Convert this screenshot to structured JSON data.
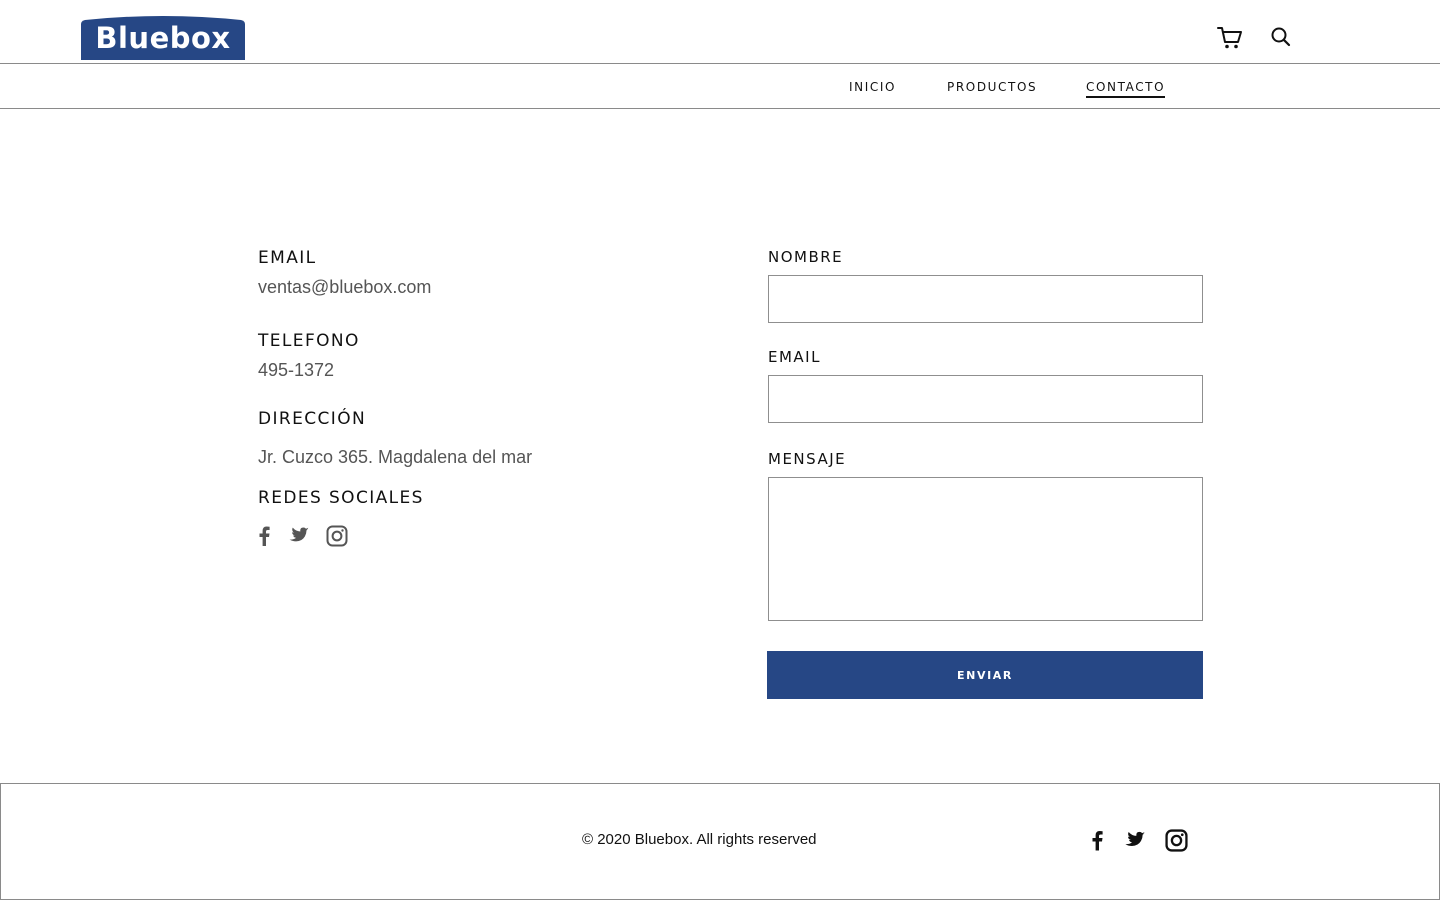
{
  "brand": {
    "name": "Bluebox",
    "color": "#264785"
  },
  "header": {
    "icons": [
      "cart-icon",
      "search-icon"
    ],
    "nav": [
      {
        "label": "INICIO",
        "active": false
      },
      {
        "label": "PRODUCTOS",
        "active": false
      },
      {
        "label": "CONTACTO",
        "active": true
      }
    ]
  },
  "contact_info": {
    "email_title": "EMAIL",
    "email_value": "ventas@bluebox.com",
    "phone_title": "TELEFONO",
    "phone_value": "495-1372",
    "address_title": "DIRECCIÓN",
    "address_value": "Jr. Cuzco 365. Magdalena del mar",
    "social_title": "REDES SOCIALES",
    "social_icons": [
      "facebook-icon",
      "twitter-icon",
      "instagram-icon"
    ]
  },
  "form": {
    "name_label": "NOMBRE",
    "name_value": "",
    "email_label": "EMAIL",
    "email_value": "",
    "message_label": "MENSAJE",
    "message_value": "",
    "submit_label": "ENVIAR"
  },
  "footer": {
    "copyright": "© 2020 Bluebox. All rights reserved",
    "social_icons": [
      "facebook-icon",
      "twitter-icon",
      "instagram-icon"
    ]
  },
  "colors": {
    "text_muted": "#555555",
    "border": "#8f8f8f",
    "button_bg": "#264785"
  }
}
